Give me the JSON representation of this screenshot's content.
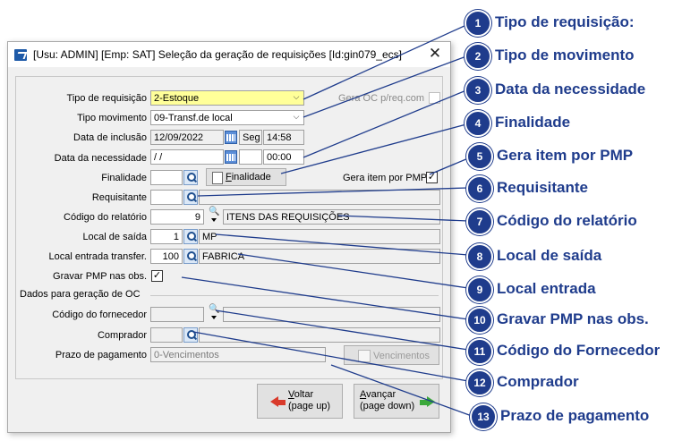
{
  "window": {
    "title": "[Usu: ADMIN] [Emp: SAT] Seleção da geração de requisições [Id:gin079_ecs]",
    "close_glyph": "✕"
  },
  "form": {
    "tipo_requisicao": {
      "label": "Tipo de requisição",
      "value": "2-Estoque"
    },
    "gera_oc": {
      "label": "Gera OC p/req.com"
    },
    "tipo_movimento": {
      "label": "Tipo movimento",
      "value": "09-Transf.de local"
    },
    "data_inclusao": {
      "label": "Data de inclusão",
      "date": "12/09/2022",
      "weekday": "Seg",
      "time": "14:58"
    },
    "data_necessidade": {
      "label": "Data da necessidade",
      "date": "/  /",
      "time": "00:00"
    },
    "finalidade": {
      "label": "Finalidade",
      "button": "Finalidade",
      "button_mnemonic": "F",
      "button_rest": "inalidade"
    },
    "gera_item_pmp": {
      "label": "Gera item por PMP",
      "check": "✓"
    },
    "requisitante": {
      "label": "Requisitante"
    },
    "codigo_relatorio": {
      "label": "Código do relatório",
      "code": "9",
      "description": "ITENS DAS REQUISIÇÕES"
    },
    "local_saida": {
      "label": "Local de saída",
      "code": "1",
      "description": "MP"
    },
    "local_entrada": {
      "label": "Local entrada transfer.",
      "code": "100",
      "description": "FABRICA"
    },
    "gravar_pmp": {
      "label": "Gravar PMP nas obs.",
      "check": "✓"
    },
    "oc_section": {
      "title": "Dados para geração de OC"
    },
    "codigo_fornecedor": {
      "label": "Código do fornecedor"
    },
    "comprador": {
      "label": "Comprador"
    },
    "prazo_pagamento": {
      "label": "Prazo de pagamento",
      "value": "0-Vencimentos",
      "button": "Vencimentos"
    }
  },
  "footer": {
    "voltar": {
      "line1_mnemonic": "V",
      "line1_rest": "oltar",
      "line2": "(page up)"
    },
    "avancar": {
      "line1_mnemonic": "A",
      "line1_rest": "vançar",
      "line2": "(page down)"
    }
  },
  "callouts": [
    {
      "number": "1",
      "text": "Tipo de requisição:"
    },
    {
      "number": "2",
      "text": "Tipo de movimento"
    },
    {
      "number": "3",
      "text": "Data da necessidade"
    },
    {
      "number": "4",
      "text": "Finalidade"
    },
    {
      "number": "5",
      "text": "Gera item por PMP"
    },
    {
      "number": "6",
      "text": "Requisitante"
    },
    {
      "number": "7",
      "text": "Código do relatório"
    },
    {
      "number": "8",
      "text": "Local de saída"
    },
    {
      "number": "9",
      "text": "Local entrada"
    },
    {
      "number": "10",
      "text": "Gravar PMP nas obs."
    },
    {
      "number": "11",
      "text": "Código do Fornecedor"
    },
    {
      "number": "12",
      "text": "Comprador"
    },
    {
      "number": "13",
      "text": "Prazo de pagamento"
    }
  ],
  "colors": {
    "accent": "#1f3c8c",
    "highlight_field": "#ffff99",
    "dialog_bg": "#f0f0f0"
  }
}
